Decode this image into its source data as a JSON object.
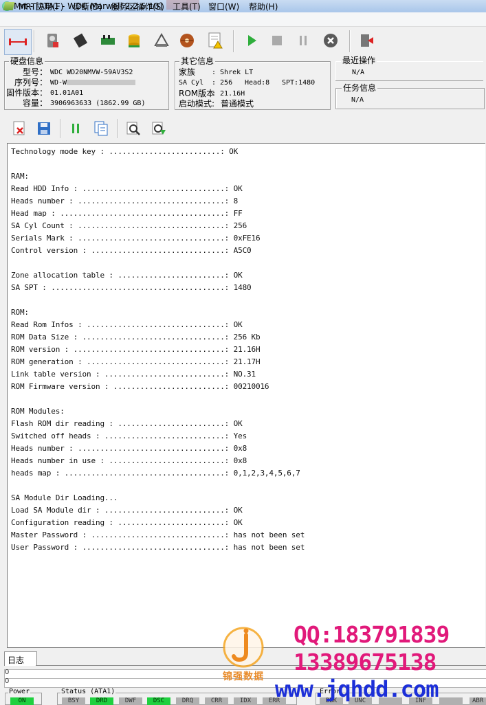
{
  "window": {
    "title": "Mrt - [ATA1 - WDC Marwell 2.2.6.10]"
  },
  "menu": [
    {
      "label": "MRT应用(F)"
    },
    {
      "label": "诊断(D)"
    },
    {
      "label": "服务区操作(S)"
    },
    {
      "label": "工具(T)"
    },
    {
      "label": "窗口(W)"
    },
    {
      "label": "帮助(H)"
    }
  ],
  "toolbar": {
    "icons": [
      "connect-icon",
      "hdd-scan-icon",
      "chip-icon",
      "board-icon",
      "database-icon",
      "recycle-icon",
      "disk-platter-icon",
      "warning-log-icon",
      "play-icon",
      "stop-icon",
      "pause-icon",
      "abort-icon",
      "exit-icon"
    ]
  },
  "disk_info": {
    "title": "硬盘信息",
    "model_label": "型号：",
    "model": "WDC WD20NMVW-59AV3S2",
    "serial_label": "序列号：",
    "serial": "WD-W",
    "firmware_label": "固件版本：",
    "firmware": "01.01A01",
    "capacity_label": "容量：",
    "capacity": "3906963633 (1862.99 GB)"
  },
  "other_info": {
    "title": "其它信息",
    "family_label": "家族",
    "family": ": Shrek LT",
    "sa_cyl_label": "SA Cyl",
    "sa_cyl": ": 256",
    "head": "Head:8",
    "spt": "SPT:1480",
    "rom_label": "ROM版本",
    "rom": ": 21.16H",
    "boot_label": "启动模式:",
    "boot": "普通模式"
  },
  "recent_op": {
    "title": "最近操作",
    "value": "N/A"
  },
  "task_info": {
    "title": "任务信息",
    "value": "N/A"
  },
  "log_toolbar": {
    "icons": [
      "clear-log-icon",
      "save-log-icon",
      "pause-log-icon",
      "copy-log-icon",
      "search-log-icon",
      "export-log-icon"
    ]
  },
  "log": {
    "lines": [
      "Technology mode key : .........................: OK",
      "",
      "RAM:",
      "Read HDD Info : ................................: OK",
      "Heads number : .................................: 8",
      "Head map : .....................................: FF",
      "SA Cyl Count : .................................: 256",
      "Serials Mark : .................................: 0xFE16",
      "Control version : ..............................: A5C0",
      "",
      "Zone allocation table : ........................: OK",
      "SA SPT : .......................................: 1480",
      "",
      "ROM:",
      "Read Rom Infos : ...............................: OK",
      "ROM Data Size : ................................: 256 Kb",
      "ROM version : ..................................: 21.16H",
      "ROM generation : ...............................: 21.17H",
      "Link table version : ...........................: NO.31",
      "ROM Firmware version : .........................: 00210016",
      "",
      "ROM Modules:",
      "Flash ROM dir reading : ........................: OK",
      "Switched off heads : ...........................: Yes",
      "Heads number : .................................: 0x8",
      "Heads number in use : ..........................: 0x8",
      "heads map : ....................................: 0,1,2,3,4,5,6,7",
      "",
      "SA Module Dir Loading...",
      "Load SA Module dir : ...........................: OK",
      "Configuration reading : ........................: OK",
      "Master Password : ..............................: has not been set",
      "User Password : ................................: has not been set"
    ]
  },
  "bottom": {
    "log_tab": "日志",
    "counter1": "0",
    "counter2": "0"
  },
  "status": {
    "power_title": "Power",
    "power_led": "ON",
    "status_title": "Status (ATA1)",
    "status_leds": [
      "BSY",
      "DRD",
      "DWF",
      "DSC",
      "DRQ",
      "CRR",
      "IDX",
      "ERR"
    ],
    "error_title": "Error",
    "error_leds": [
      "BBK",
      "UNC",
      "",
      "INF",
      "",
      "ABR"
    ]
  },
  "watermark": {
    "brand": "锦强数据",
    "qq": "QQ:183791839",
    "phone": "13389675138",
    "url": "www.jqhdd.com"
  },
  "colors": {
    "led_on": "#20d040",
    "led_off": "#b0b0b0",
    "watermark_pink": "#e1197a",
    "watermark_blue": "#1c2fd8",
    "watermark_orange": "#e88b2a"
  }
}
